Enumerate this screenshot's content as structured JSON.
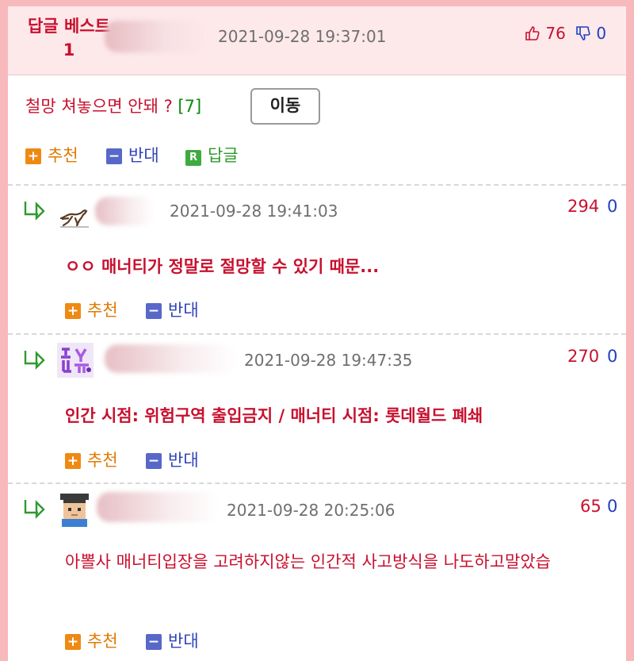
{
  "post": {
    "best_label": "답글 베스트1",
    "date": "2021-09-28 19:37:01",
    "up_votes": "76",
    "down_votes": "0",
    "title": "철망 쳐놓으면 안돼 ?",
    "reply_count": "[7]",
    "move_button": "이동",
    "actions": {
      "recommend": "추천",
      "oppose": "반대",
      "reply": "답글"
    }
  },
  "comments": [
    {
      "date": "2021-09-28 19:41:03",
      "up": "294",
      "down": "0",
      "text": "ㅇㅇ 매너티가 정말로 절망할 수 있기 때문...",
      "avatar_icon": "running-dog-icon"
    },
    {
      "date": "2021-09-28 19:47:35",
      "up": "270",
      "down": "0",
      "text": "인간 시점: 위험구역 출입금지 / 매너티 시점: 롯데월드 폐쇄",
      "avatar_icon": "pixel-text-icon"
    },
    {
      "date": "2021-09-28 20:25:06",
      "up": "65",
      "down": "0",
      "text": "아뽈사 매너티입장을 고려하지않는 인간적 사고방식을 나도하고말았습",
      "avatar_icon": "pixel-graduate-icon"
    }
  ],
  "labels": {
    "recommend": "추천",
    "oppose": "반대"
  },
  "colors": {
    "accent_red": "#c8102e",
    "down_blue": "#1f3fbf",
    "reply_green": "#2e9a2e",
    "frame_pink": "#f7b9bc"
  }
}
